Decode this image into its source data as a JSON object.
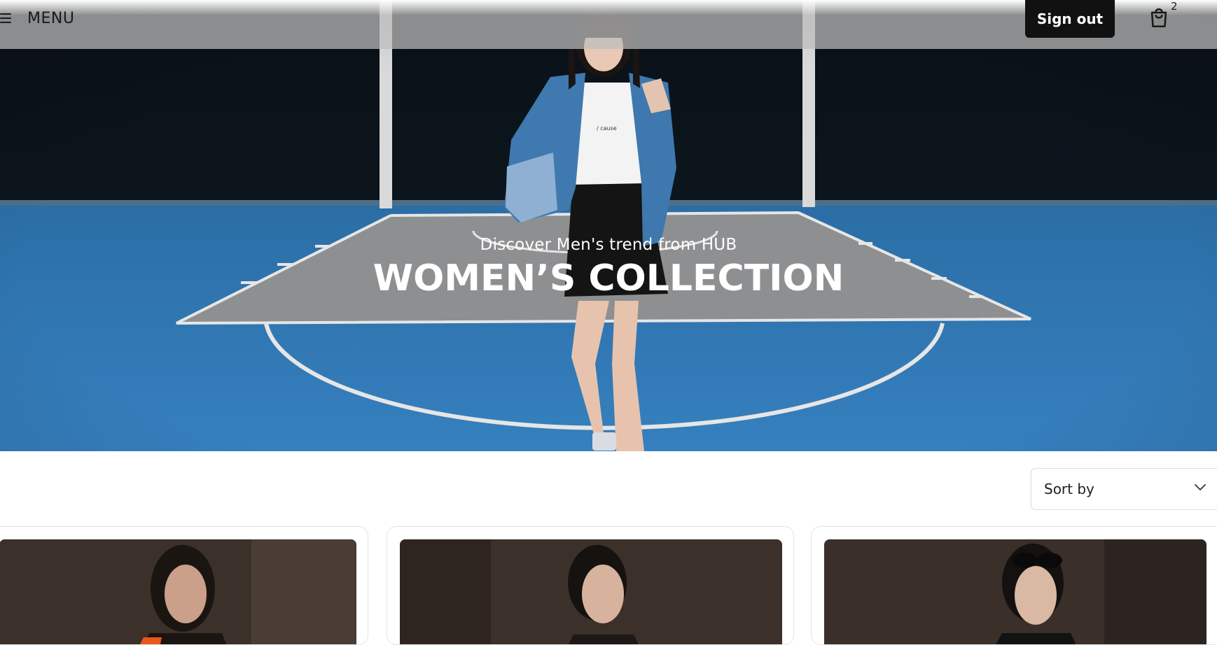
{
  "header": {
    "menu_label": "MENU",
    "signout_label": "Sign out",
    "cart_count": "2",
    "icons": {
      "menu": "hamburger-icon",
      "cart": "shopping-bag-icon"
    }
  },
  "hero": {
    "subtitle": "Discover Men's trend from HUB",
    "title": "WOMEN’S COLLECTION"
  },
  "toolbar": {
    "sort_label": "Sort by",
    "sort_icon": "chevron-down-icon"
  },
  "colors": {
    "court_blue": "#2f77b3",
    "key_grey": "#8e8f91",
    "button_black": "#111111"
  }
}
